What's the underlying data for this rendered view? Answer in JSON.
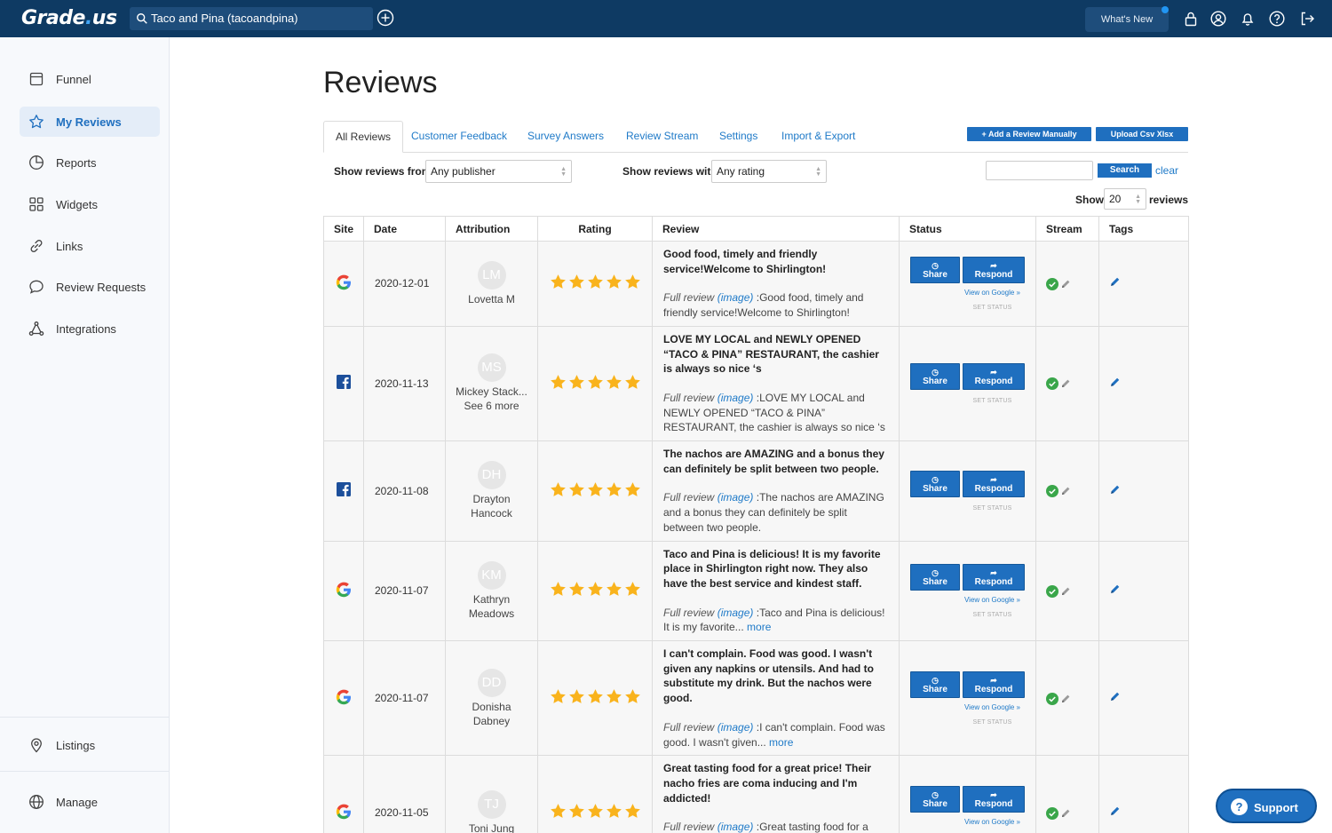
{
  "app": {
    "logo_left": "Grade",
    "logo_dot": ".",
    "logo_right": "us"
  },
  "topbar": {
    "search_value": "Taco and Pina (tacoandpina)",
    "whats_new": "What's New",
    "icons": [
      "lock-icon",
      "account-icon",
      "bell-icon",
      "help-icon",
      "logout-icon"
    ]
  },
  "sidebar": {
    "items": [
      {
        "label": "Funnel",
        "icon": "funnel-icon",
        "active": false
      },
      {
        "label": "My Reviews",
        "icon": "star-icon",
        "active": true
      },
      {
        "label": "Reports",
        "icon": "pie-chart-icon",
        "active": false
      },
      {
        "label": "Widgets",
        "icon": "grid-icon",
        "active": false
      },
      {
        "label": "Links",
        "icon": "link-icon",
        "active": false
      },
      {
        "label": "Review Requests",
        "icon": "chat-bubble-icon",
        "active": false
      },
      {
        "label": "Integrations",
        "icon": "network-icon",
        "active": false
      }
    ],
    "bottom": [
      {
        "label": "Listings",
        "icon": "location-pin-icon"
      },
      {
        "label": "Manage",
        "icon": "globe-icon"
      }
    ]
  },
  "page": {
    "title": "Reviews"
  },
  "tabs": [
    "All Reviews",
    "Customer Feedback",
    "Survey Answers",
    "Review Stream",
    "Settings",
    "Import & Export"
  ],
  "actions": {
    "add_review": "+ Add a Review Manually",
    "upload": "Upload Csv Xlsx"
  },
  "filters": {
    "from_label": "Show reviews from",
    "from_value": "Any publisher",
    "with_label": "Show reviews with",
    "with_value": "Any rating",
    "search_btn": "Search",
    "clear": "clear",
    "show_label": "Show",
    "show_value": "20",
    "reviews_label": "reviews"
  },
  "table": {
    "headers": [
      "Site",
      "Date",
      "Attribution",
      "Rating",
      "Review",
      "Status",
      "Stream",
      "Tags"
    ],
    "full_review_label": "Full review",
    "image_label": "(image)",
    "more_label": "more",
    "share_label": "Share",
    "respond_label": "Respond",
    "view_on_google": "View on Google »",
    "set_status": "SET STATUS",
    "rows": [
      {
        "site": "google",
        "date": "2020-12-01",
        "initials": "LM",
        "name": "Lovetta M",
        "name2": "",
        "rating": 5,
        "title": "Good food, timely and friendly service!Welcome to Shirlington!",
        "full": ":Good food, timely and friendly service!Welcome to Shirlington!",
        "more": false,
        "google_link": true
      },
      {
        "site": "facebook",
        "date": "2020-11-13",
        "initials": "MS",
        "name": "Mickey Stack...",
        "name2": "See 6 more",
        "rating": 5,
        "title": "LOVE MY LOCAL and NEWLY OPENED “TACO & PINA” RESTAURANT, the cashier is always so nice ‘s",
        "full": ":LOVE MY LOCAL and NEWLY OPENED “TACO & PINA” RESTAURANT, the cashier is always so nice ‘s",
        "more": false,
        "google_link": false
      },
      {
        "site": "facebook",
        "date": "2020-11-08",
        "initials": "DH",
        "name": "Drayton",
        "name2": "Hancock",
        "rating": 5,
        "title": "The nachos are AMAZING and a bonus they can definitely be split between two people.",
        "full": ":The nachos are AMAZING and a bonus they can definitely be split between two people.",
        "more": false,
        "google_link": false
      },
      {
        "site": "google",
        "date": "2020-11-07",
        "initials": "KM",
        "name": "Kathryn",
        "name2": "Meadows",
        "rating": 5,
        "title": "Taco and Pina is delicious! It is my favorite place in Shirlington right now. They also have the best service and kindest staff.",
        "full": ":Taco and Pina is delicious! It is my favorite...",
        "more": true,
        "google_link": true
      },
      {
        "site": "google",
        "date": "2020-11-07",
        "initials": "DD",
        "name": "Donisha",
        "name2": "Dabney",
        "rating": 5,
        "title": "I can't complain. Food was good. I wasn't given any napkins or utensils. And had to substitute my drink. But the nachos were good.",
        "full": ":I can't complain. Food was good. I wasn't given...",
        "more": true,
        "google_link": true
      },
      {
        "site": "google",
        "date": "2020-11-05",
        "initials": "TJ",
        "name": "Toni Jung",
        "name2": "",
        "rating": 5,
        "title": "Great tasting food for a great price! Their nacho fries are coma inducing and I'm addicted!",
        "full": ":Great tasting food for a great price! Their nacho fries are coma inducing and I'm...",
        "more": true,
        "google_link": true
      }
    ]
  },
  "support": {
    "label": "Support"
  },
  "colors": {
    "topbar": "#0e3a63",
    "accent": "#1f6fbf",
    "star": "#f9b31c",
    "check": "#3aa64a"
  }
}
